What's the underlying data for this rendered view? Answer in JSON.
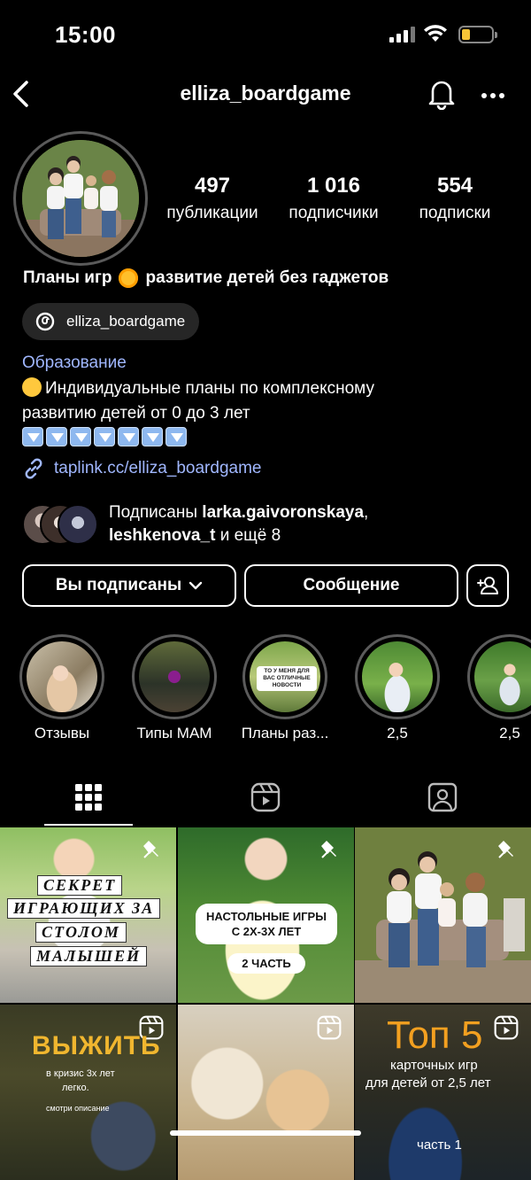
{
  "status_bar": {
    "time": "15:00"
  },
  "header": {
    "username": "elliza_boardgame"
  },
  "stats": [
    {
      "value": "497",
      "label": "публикации"
    },
    {
      "value": "1 016",
      "label": "подписчики"
    },
    {
      "value": "554",
      "label": "подписки"
    }
  ],
  "bio": {
    "name_left": "Планы игр",
    "name_right": "развитие детей без гаджетов",
    "threads_handle": "elliza_boardgame",
    "category": "Образование",
    "line1": "Индивидуальные планы по комплексному",
    "line2": "развитию детей от 0 до 3 лет",
    "link": "taplink.cc/elliza_boardgame"
  },
  "followers": {
    "prefix": "Подписаны",
    "user1": "larka.gaivoronskaya",
    "comma": ",",
    "user2": "leshkenova_t",
    "suffix": "и ещё 8"
  },
  "buttons": {
    "following": "Вы подписаны",
    "message": "Сообщение"
  },
  "highlights": [
    {
      "label": "Отзывы"
    },
    {
      "label": "Типы МАМ"
    },
    {
      "label": "Планы раз..."
    },
    {
      "label": "2,5"
    },
    {
      "label": "2,5"
    }
  ],
  "posts": {
    "p1": [
      "СЕКРЕТ",
      "ИГРАЮЩИХ ЗА",
      "СТОЛОМ",
      "МАЛЫШЕЙ"
    ],
    "p2": [
      "НАСТОЛЬНЫЕ ИГРЫ",
      "С 2Х-3Х ЛЕТ",
      "2 ЧАСТЬ"
    ],
    "p4": [
      "ВЫЖИТЬ",
      "в кризис 3х лет",
      "легко.",
      "смотри описание"
    ],
    "p6": [
      "Топ 5",
      "карточных игр",
      "для детей от 2,5 лет",
      "часть 1"
    ]
  },
  "highlight_texts": {
    "h3": [
      "ТО У МЕНЯ ДЛЯ",
      "ВАС ОТЛИЧНЫЕ",
      "НОВОСТИ"
    ]
  }
}
